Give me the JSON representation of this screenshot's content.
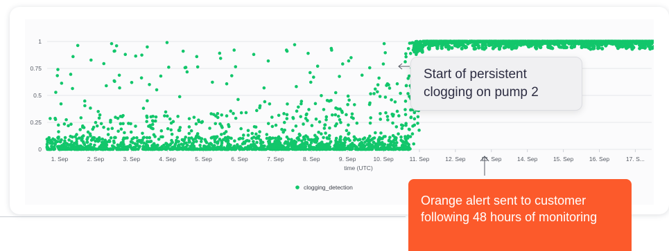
{
  "colors": {
    "series": "#12c66b",
    "orange": "#fc5a2b",
    "grey_box": "#f0f0f2"
  },
  "annotations": {
    "persistent_clogging": "Start of persistent clogging on pump 2",
    "orange_alert": "Orange alert sent to customer following 48 hours of monitoring"
  },
  "chart_data": {
    "type": "scatter",
    "title": "",
    "xlabel": "time (UTC)",
    "ylabel": "",
    "x_tick_labels": [
      "1. Sep",
      "2. Sep",
      "3. Sep",
      "4. Sep",
      "5. Sep",
      "6. Sep",
      "7. Sep",
      "8. Sep",
      "9. Sep",
      "10. Sep",
      "11. Sep",
      "12. Sep",
      "13. Sep",
      "14. Sep",
      "15. Sep",
      "16. Sep",
      "17. S..."
    ],
    "y_tick_labels": [
      "0",
      "0.25",
      "0.5",
      "0.75",
      "1"
    ],
    "ylim": [
      0,
      1
    ],
    "xlim_days": [
      "2023-08-31T12:00",
      "2023-09-17T12:00"
    ],
    "grid": true,
    "legend": "bottom-center",
    "series": [
      {
        "name": "clogging_detection",
        "description": "Sporadic detections (mostly 0–0.1, scattered up to 1.0) from 1 Sep to ~9.8 Sep; persistent values ~0.97–1.0 from ~10 Sep onwards",
        "sample_points": [
          [
            "1. Sep",
            0.86
          ],
          [
            "1. Sep",
            0.74
          ],
          [
            "2. Sep",
            0.98
          ],
          [
            "2. Sep",
            0.96
          ],
          [
            "2. Sep",
            0.91
          ],
          [
            "2. Sep",
            0.63
          ],
          [
            "3. Sep",
            0.62
          ],
          [
            "3. Sep",
            0.45
          ],
          [
            "4. Sep",
            0.99
          ],
          [
            "4. Sep",
            0.91
          ],
          [
            "4. Sep",
            0.76
          ],
          [
            "5. Sep",
            0.86
          ],
          [
            "6. Sep",
            0.92
          ],
          [
            "6. Sep",
            0.88
          ],
          [
            "7. Sep",
            0.97
          ],
          [
            "7. Sep",
            0.92
          ],
          [
            "8. Sep",
            0.92
          ],
          [
            "8. Sep",
            0.89
          ],
          [
            "9. Sep",
            0.82
          ],
          [
            "9. Sep",
            0.85
          ],
          [
            "10. Sep",
            0.98
          ],
          [
            "12. Sep",
            0.99
          ],
          [
            "14. Sep",
            0.98
          ],
          [
            "16. Sep",
            0.99
          ]
        ]
      }
    ]
  }
}
